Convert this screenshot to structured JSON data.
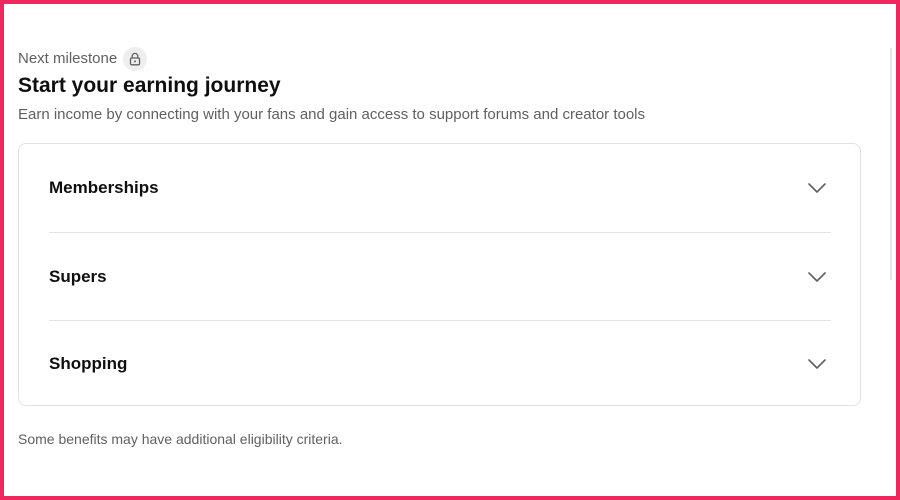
{
  "milestone": {
    "label": "Next milestone",
    "icon": "lock-icon"
  },
  "header": {
    "title": "Start your earning journey",
    "subtitle": "Earn income by connecting with your fans and gain access to support forums and creator tools"
  },
  "benefits": {
    "items": [
      {
        "label": "Memberships",
        "icon": "chevron-down-icon",
        "expanded": false
      },
      {
        "label": "Supers",
        "icon": "chevron-down-icon",
        "expanded": false
      },
      {
        "label": "Shopping",
        "icon": "chevron-down-icon",
        "expanded": false
      }
    ]
  },
  "footnote": "Some benefits may have additional eligibility criteria.",
  "colors": {
    "frame_border": "#f0265f",
    "primary_text": "#0f0f0f",
    "secondary_text": "#606060",
    "card_border": "#e2e2e2",
    "badge_bg": "#eeeeee"
  }
}
